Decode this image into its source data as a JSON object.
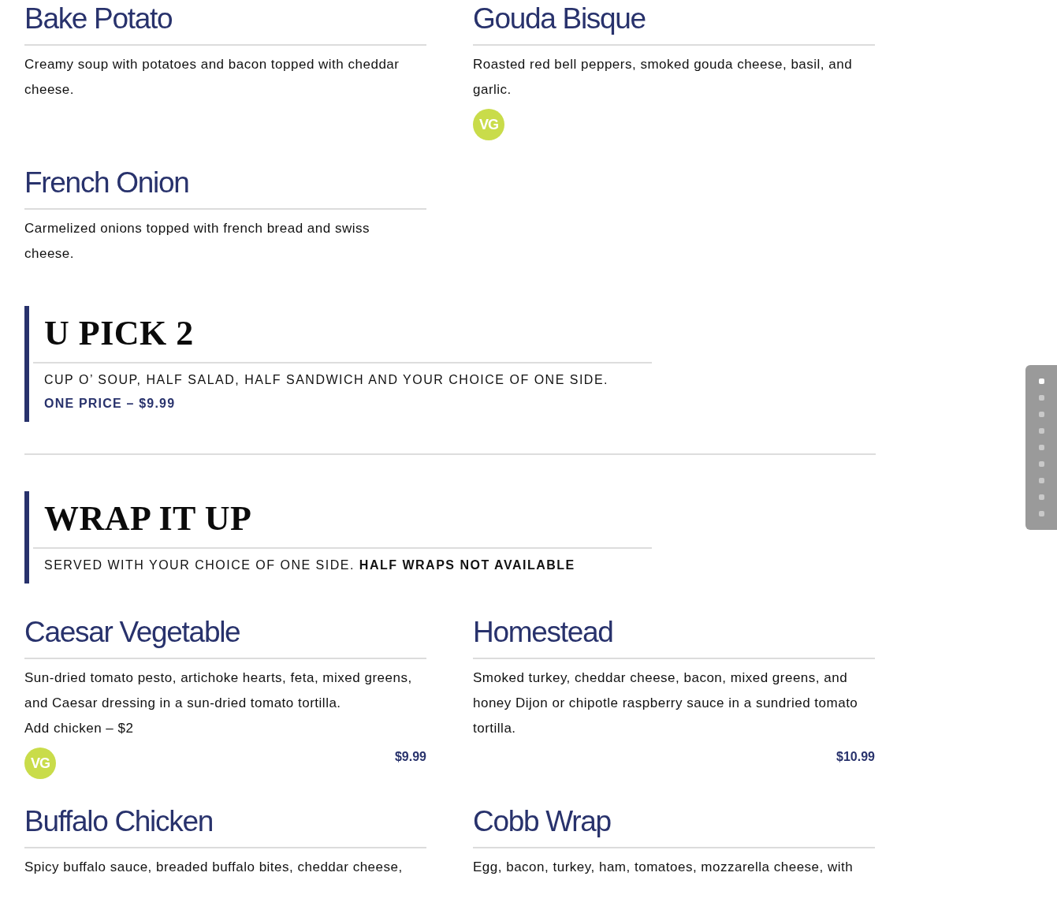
{
  "soup_items": [
    {
      "name": "Bake Potato",
      "description": "Creamy soup with potatoes and bacon topped with cheddar cheese."
    },
    {
      "name": "Gouda Bisque",
      "description": "Roasted red bell peppers, smoked gouda cheese, basil, and garlic.",
      "tags": [
        "VG"
      ]
    },
    {
      "name": "French Onion",
      "description": "Carmelized onions topped with french bread and swiss cheese."
    }
  ],
  "sections": [
    {
      "title": "U PICK 2",
      "note": "CUP O’ SOUP, HALF SALAD, HALF SANDWICH AND YOUR CHOICE OF ONE SIDE.",
      "price_line": "ONE PRICE – $9.99"
    },
    {
      "title": "WRAP IT UP",
      "note": "SERVED WITH YOUR CHOICE OF ONE SIDE. **HALF WRAPS NOT AVAILABLE**",
      "items": [
        {
          "name": "Caesar Vegetable",
          "description": "Sun-dried tomato pesto, artichoke hearts, feta, mixed greens, and Caesar dressing in a sun-dried tomato tortilla.",
          "add_on": "Add chicken – $2",
          "tags": [
            "VG"
          ],
          "price": "$9.99"
        },
        {
          "name": "Homestead",
          "description": "Smoked turkey, cheddar cheese, bacon, mixed greens, and honey Dijon or chipotle raspberry sauce in a sundried tomato tortilla.",
          "price": "$10.99"
        },
        {
          "name": "Buffalo Chicken",
          "description": "Spicy buffalo sauce, breaded buffalo bites, cheddar cheese,"
        },
        {
          "name": "Cobb Wrap",
          "description": "Egg, bacon, turkey, ham, tomatoes, mozzarella cheese, with"
        }
      ]
    }
  ],
  "side_nav": {
    "dots": [
      {
        "selected": true
      },
      {
        "selected": false
      },
      {
        "selected": false
      },
      {
        "selected": false
      },
      {
        "selected": false
      },
      {
        "selected": false
      },
      {
        "selected": false
      },
      {
        "selected": false
      },
      {
        "selected": false
      }
    ]
  }
}
